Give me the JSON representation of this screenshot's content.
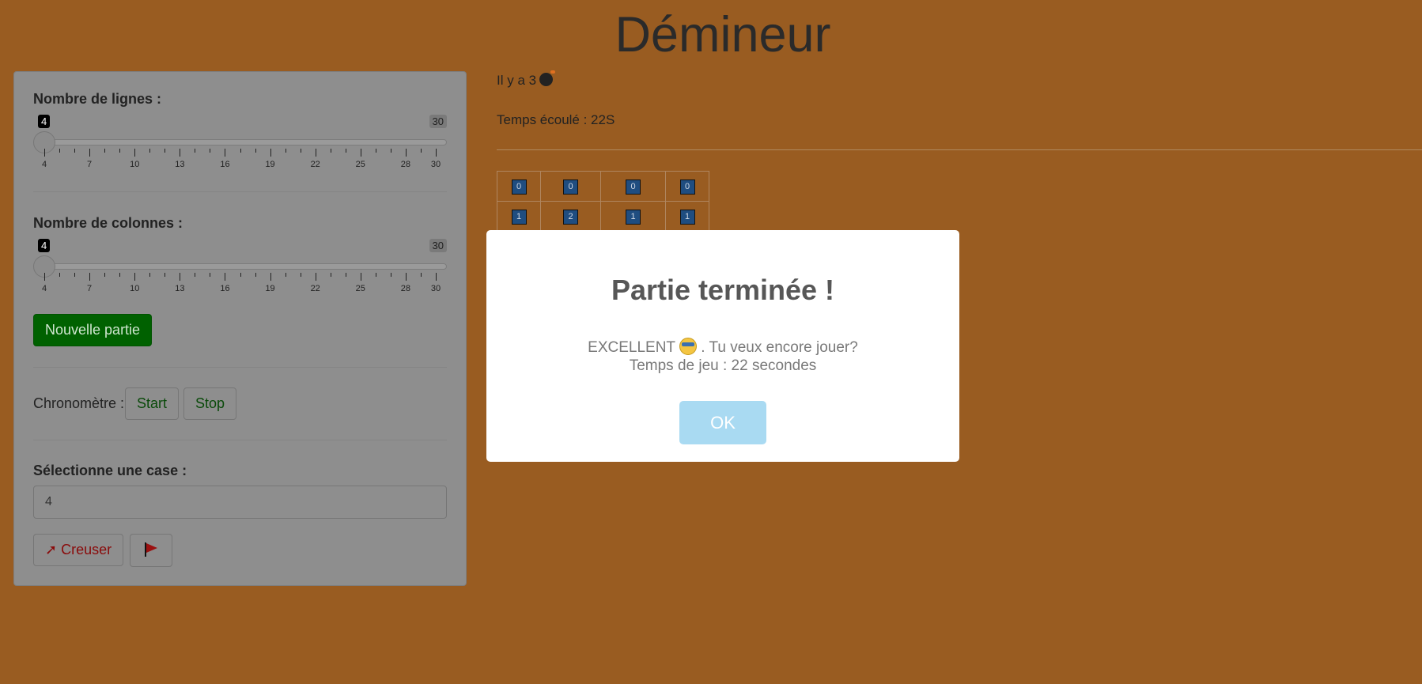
{
  "title": "Démineur",
  "sidebar": {
    "rows_label": "Nombre de lignes :",
    "rows_slider": {
      "value": "4",
      "max": "30",
      "ticks": [
        "4",
        "7",
        "10",
        "13",
        "16",
        "19",
        "22",
        "25",
        "28",
        "30"
      ]
    },
    "cols_label": "Nombre de colonnes :",
    "cols_slider": {
      "value": "4",
      "max": "30",
      "ticks": [
        "4",
        "7",
        "10",
        "13",
        "16",
        "19",
        "22",
        "25",
        "28",
        "30"
      ]
    },
    "new_game_label": "Nouvelle partie",
    "chrono_label": "Chronomètre :",
    "start_label": "Start",
    "stop_label": "Stop",
    "select_label": "Sélectionne une case :",
    "select_value": "4",
    "dig_label": "Creuser"
  },
  "main": {
    "bomb_count_text": "Il y a 3",
    "elapsed_text": "Temps écoulé : 22S",
    "board": [
      [
        "0",
        "0",
        "0",
        "0"
      ],
      [
        "1",
        "2",
        "1",
        "1"
      ]
    ]
  },
  "modal": {
    "title": "Partie terminée !",
    "line1_a": "EXCELLENT",
    "line1_b": ". Tu veux encore jouer?",
    "line2": "Temps de jeu : 22 secondes",
    "ok_label": "OK"
  },
  "colors": {
    "background": "#995c21",
    "green_button": "#006100",
    "ok_button": "#a9daf2"
  },
  "icons": [
    "bomb-icon",
    "pickaxe-icon",
    "flag-icon",
    "smile-sunglasses-icon"
  ]
}
